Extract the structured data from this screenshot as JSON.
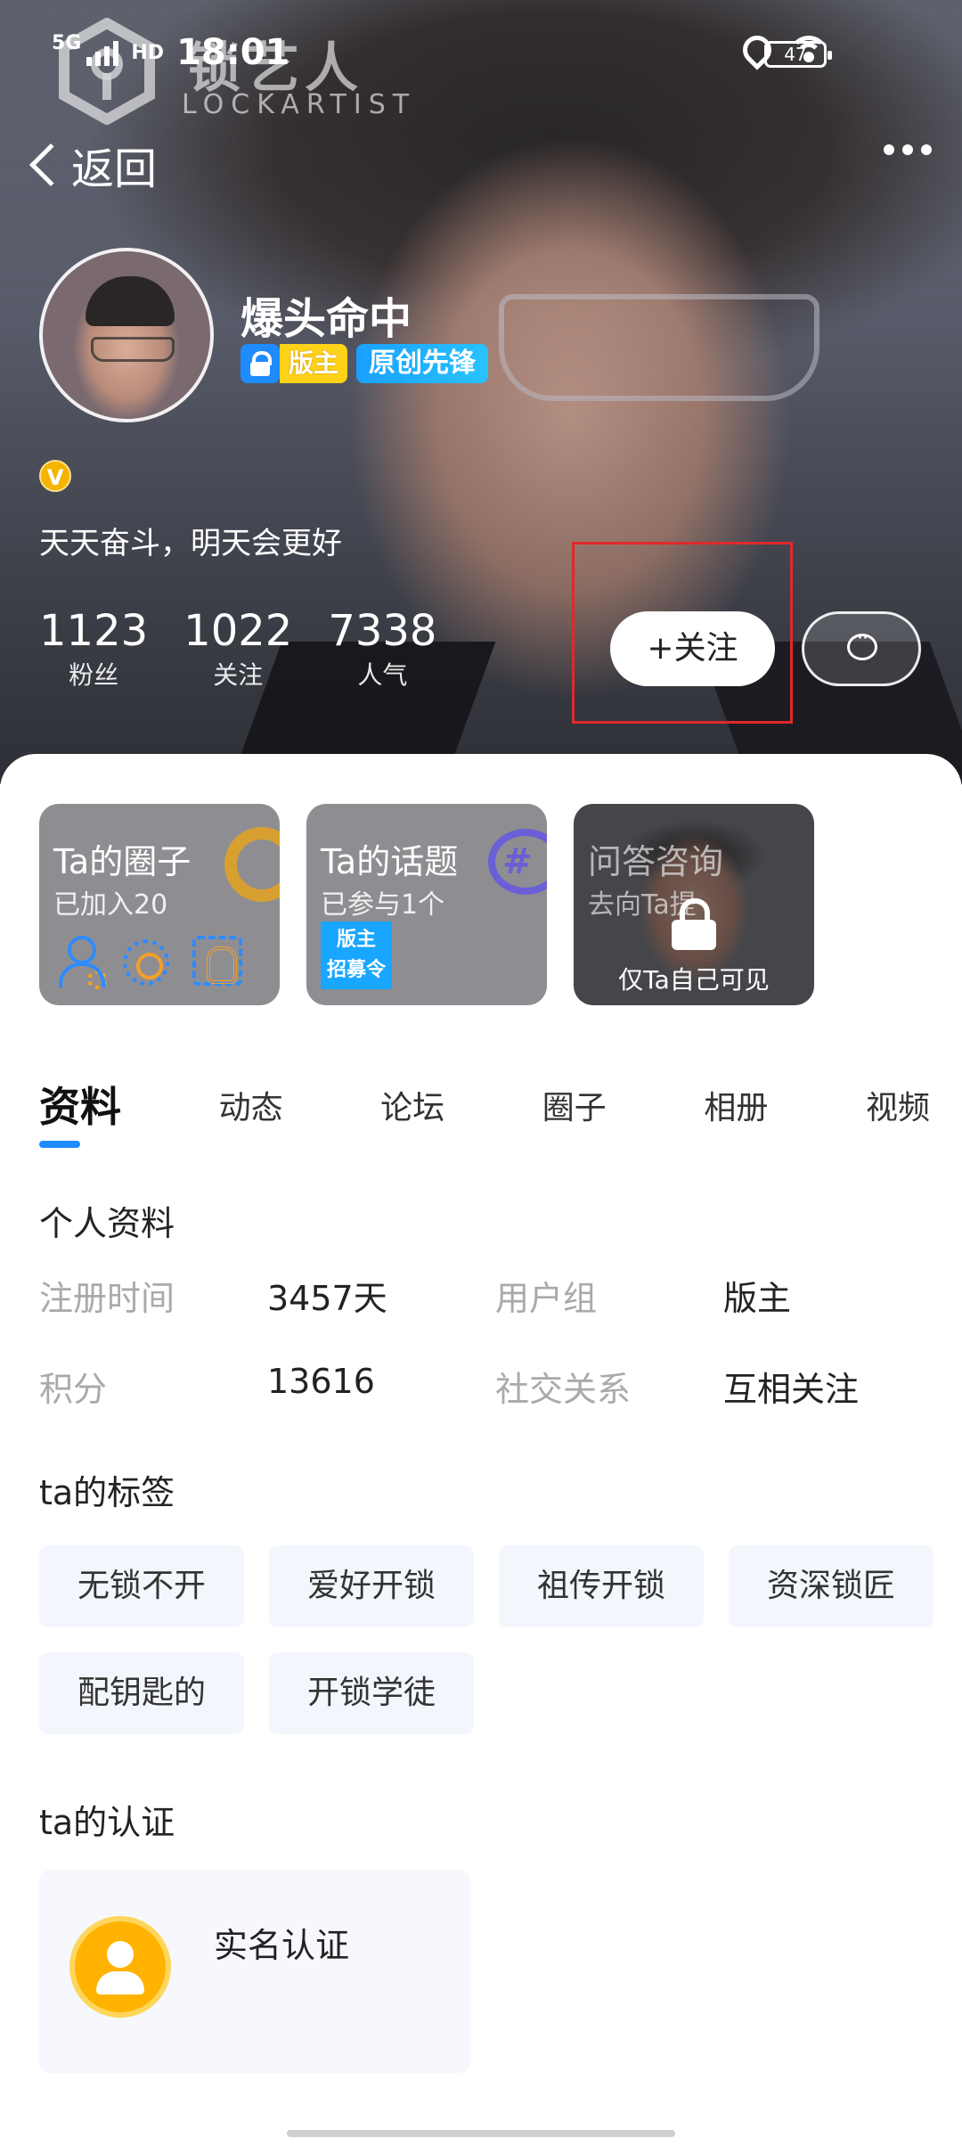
{
  "status_bar": {
    "network": "5G",
    "hd": "HD",
    "time": "18:01",
    "battery": "47"
  },
  "watermark": {
    "title": "锁艺人",
    "subtitle": "LOCKARTIST"
  },
  "nav": {
    "back_label": "返回"
  },
  "profile": {
    "username": "爆头命中",
    "badge_moderator": "版主",
    "badge_original": "原创先锋",
    "verify_mark": "V",
    "signature": "天天奋斗，明天会更好",
    "stats": [
      {
        "value": "1123",
        "label": "粉丝"
      },
      {
        "value": "1022",
        "label": "关注"
      },
      {
        "value": "7338",
        "label": "人气"
      }
    ],
    "follow_label": "+关注"
  },
  "cards": {
    "circle": {
      "title": "Ta的圈子",
      "sub": "已加入20"
    },
    "topic": {
      "title": "Ta的话题",
      "sub": "已参与1个",
      "recruit_line1": "版主",
      "recruit_line2": "招募令"
    },
    "qa": {
      "title": "问答咨询",
      "sub": "去向Ta提",
      "lock_text": "仅Ta自己可见"
    }
  },
  "tabs": [
    "资料",
    "动态",
    "论坛",
    "圈子",
    "相册",
    "视频"
  ],
  "personal_info": {
    "title": "个人资料",
    "reg_time_key": "注册时间",
    "reg_time_val": "3457天",
    "group_key": "用户组",
    "group_val": "版主",
    "points_key": "积分",
    "points_val": "13616",
    "relation_key": "社交关系",
    "relation_val": "互相关注"
  },
  "tags_section": {
    "title": "ta的标签",
    "tags": [
      "无锁不开",
      "爱好开锁",
      "祖传开锁",
      "资深锁匠",
      "配钥匙的",
      "开锁学徒"
    ]
  },
  "cert_section": {
    "title": "ta的认证",
    "item": "实名认证"
  },
  "colors": {
    "accent": "#1e8bff",
    "highlight_box": "#e0292b",
    "moderator_badge": "#ffd21a",
    "cert_icon": "#ffb300"
  }
}
